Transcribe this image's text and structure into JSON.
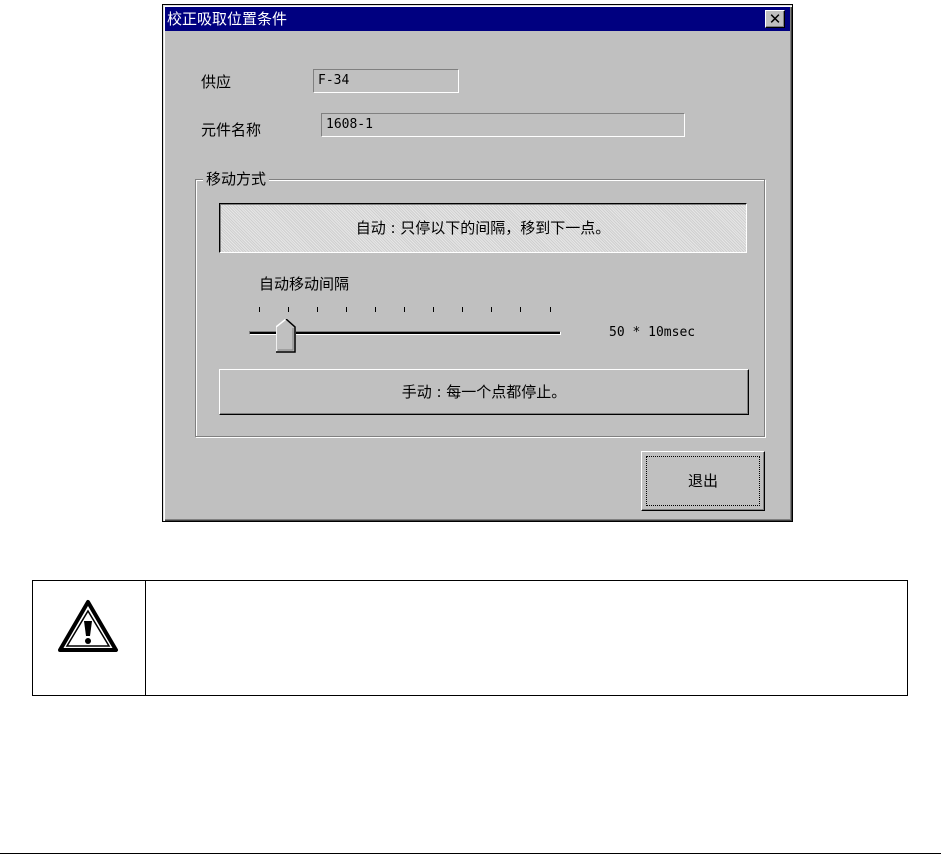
{
  "dialog": {
    "title": "校正吸取位置条件",
    "close_glyph": "✕"
  },
  "fields": {
    "feeder_label": "供应",
    "feeder_value": "F-34",
    "part_name_label": "元件名称",
    "part_name_value": "1608-1"
  },
  "move_mode": {
    "group_label": "移动方式",
    "auto_button": "自动 : 只停以下的间隔，移到下一点。",
    "auto_interval_label": "自动移动间隔",
    "slider_value_text": "50 * 10msec",
    "manual_button": "手动 : 每一个点都停止。"
  },
  "exit_button": "退出",
  "warning": {
    "icon": "warning-triangle-icon",
    "text": ""
  },
  "colors": {
    "titlebar": "#000080",
    "dialog_face": "#c0c0c0"
  }
}
